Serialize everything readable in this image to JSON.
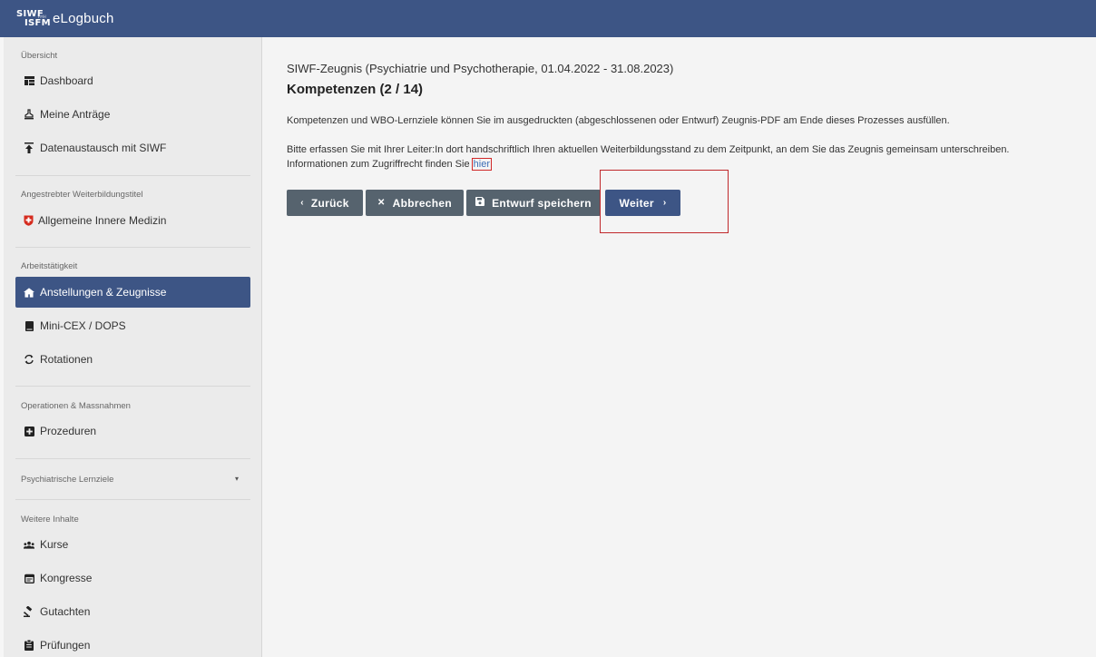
{
  "header": {
    "logo_line1": "SIWF",
    "logo_line2": "ISFM",
    "logo_small": "FMH",
    "app_name": "eLogbuch",
    "bg_color": "#3d5585"
  },
  "sidebar": {
    "sections": {
      "overview": "Übersicht",
      "title_section": "Angestrebter Weiterbildungstitel",
      "work": "Arbeitstätigkeit",
      "operations": "Operationen & Massnahmen",
      "psych": "Psychiatrische Lernziele",
      "more": "Weitere Inhalte"
    },
    "items": {
      "dashboard": "Dashboard",
      "antraege": "Meine Anträge",
      "datenaustausch": "Datenaustausch mit SIWF",
      "innere_medizin": "Allgemeine Innere Medizin",
      "anstellungen": "Anstellungen & Zeugnisse",
      "minicex": "Mini-CEX / DOPS",
      "rotationen": "Rotationen",
      "prozeduren": "Prozeduren",
      "kurse": "Kurse",
      "kongresse": "Kongresse",
      "gutachten": "Gutachten",
      "pruefungen": "Prüfungen"
    },
    "icons": {
      "dashboard": "dashboard-icon",
      "antraege": "stamp-icon",
      "datenaustausch": "upload-icon",
      "innere_medizin": "swiss-shield-icon",
      "anstellungen": "house-icon",
      "minicex": "book-icon",
      "rotationen": "rotate-icon",
      "prozeduren": "plus-square-icon",
      "kurse": "users-icon",
      "kongresse": "calendar-icon",
      "gutachten": "gavel-icon",
      "pruefungen": "clipboard-icon"
    }
  },
  "main": {
    "subtitle": "SIWF-Zeugnis (Psychiatrie und Psychotherapie, 01.04.2022 - 31.08.2023)",
    "title": "Kompetenzen (2 / 14)",
    "paragraph1": "Kompetenzen und WBO-Lernziele können Sie im ausgedruckten (abgeschlossenen oder Entwurf) Zeugnis-PDF am Ende dieses Prozesses ausfüllen.",
    "paragraph2_line1": "Bitte erfassen Sie mit Ihrer Leiter:In dort handschriftlich Ihren aktuellen Weiterbildungsstand zu dem Zeitpunkt, an dem Sie das Zeugnis gemeinsam unterschreiben.",
    "paragraph2_line2": "Informationen zum Zugriffrecht finden Sie",
    "link_text": "hier",
    "buttons": {
      "back": "Zurück",
      "cancel": "Abbrechen",
      "save_draft": "Entwurf speichern",
      "next": "Weiter"
    }
  }
}
